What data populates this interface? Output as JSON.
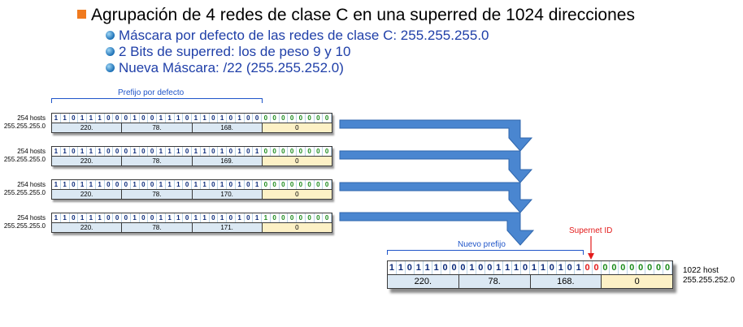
{
  "title": "Agrupación de 4 redes de clase C en una superred de 1024 direcciones",
  "bullets": [
    "Máscara por defecto de las redes de clase C: 255.255.255.0",
    "2 Bits de superred: los de peso 9 y 10",
    "Nueva Máscara: /22 (255.255.252.0)"
  ],
  "prefix_label": "Prefijo por defecto",
  "networks": [
    {
      "hosts": "254 hosts",
      "mask": "255.255.255.0",
      "bits": "11011100010011101101010000000000",
      "octets": [
        "220.",
        "78.",
        "168.",
        "0"
      ]
    },
    {
      "hosts": "254 hosts",
      "mask": "255.255.255.0",
      "bits": "11011100010011101101010100000000",
      "octets": [
        "220.",
        "78.",
        "169.",
        "0"
      ]
    },
    {
      "hosts": "254 hosts",
      "mask": "255.255.255.0",
      "bits": "11011100010011101101010100000000",
      "octets": [
        "220.",
        "78.",
        "170.",
        "0"
      ]
    },
    {
      "hosts": "254 hosts",
      "mask": "255.255.255.0",
      "bits": "11011100010011101101010110000000",
      "octets": [
        "220.",
        "78.",
        "171.",
        "0"
      ]
    }
  ],
  "supernet": {
    "id_label": "Supernet ID",
    "prefix_label": "Nuevo prefijo",
    "bits": "11011100010011101101010000000000",
    "octets": [
      "220.",
      "78.",
      "168.",
      "0"
    ],
    "hosts": "1022 host",
    "mask": "255.255.252.0"
  },
  "colors": {
    "arrow": "#4a86d0",
    "network_bits": "#0b2a7a",
    "host_bits": "#1a8a1a",
    "supernet_bits": "#e31b1b",
    "net_fill": "#dbe8f3",
    "host_fill": "#fdf1c6",
    "title_bullet": "#f07a1e"
  }
}
